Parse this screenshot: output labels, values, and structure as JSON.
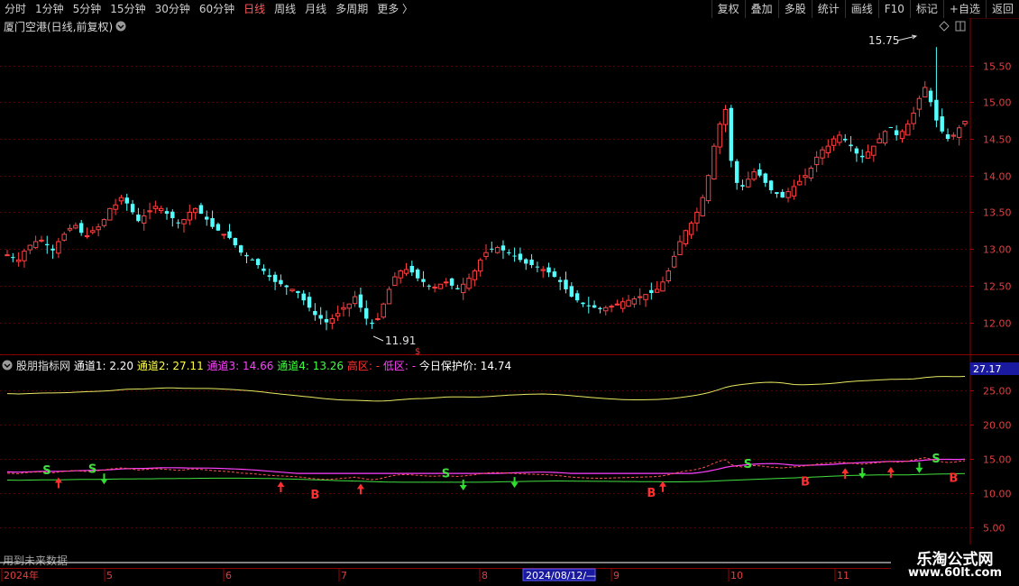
{
  "toolbar": {
    "left": [
      {
        "id": "tab-fenshi",
        "label": "分时",
        "active": false
      },
      {
        "id": "tab-1min",
        "label": "1分钟",
        "active": false
      },
      {
        "id": "tab-5min",
        "label": "5分钟",
        "active": false
      },
      {
        "id": "tab-15min",
        "label": "15分钟",
        "active": false
      },
      {
        "id": "tab-30min",
        "label": "30分钟",
        "active": false
      },
      {
        "id": "tab-60min",
        "label": "60分钟",
        "active": false
      },
      {
        "id": "tab-day",
        "label": "日线",
        "active": true
      },
      {
        "id": "tab-week",
        "label": "周线",
        "active": false
      },
      {
        "id": "tab-month",
        "label": "月线",
        "active": false
      },
      {
        "id": "tab-multi",
        "label": "多周期",
        "active": false
      },
      {
        "id": "tab-more",
        "label": "更多 〉",
        "active": false
      }
    ],
    "right": [
      {
        "id": "btn-fuquan",
        "label": "复权"
      },
      {
        "id": "btn-diejia",
        "label": "叠加"
      },
      {
        "id": "btn-duogu",
        "label": "多股"
      },
      {
        "id": "btn-tongji",
        "label": "统计"
      },
      {
        "id": "btn-huaxian",
        "label": "画线"
      },
      {
        "id": "btn-f10",
        "label": "F10"
      },
      {
        "id": "btn-biaoji",
        "label": "标记"
      },
      {
        "id": "btn-zixuan",
        "label": "+自选"
      },
      {
        "id": "btn-fanhui",
        "label": "返回"
      }
    ]
  },
  "main_chart": {
    "title": "厦门空港(日线,前复权)",
    "high_label": "15.75",
    "low_label": "11.91",
    "y_ticks": [
      "15.50",
      "15.00",
      "14.50",
      "14.00",
      "13.50",
      "13.00",
      "12.50",
      "12.00"
    ]
  },
  "indicator": {
    "name": "股朋指标网",
    "items": [
      {
        "label": "通道1: 2.20",
        "color": "#ffffff"
      },
      {
        "label": "通道2: 27.11",
        "color": "#ffff40"
      },
      {
        "label": "通道3: 14.66",
        "color": "#ff40ff"
      },
      {
        "label": "通道4: 13.26",
        "color": "#40ff40"
      },
      {
        "label": "高区: -",
        "color": "#ff3030"
      },
      {
        "label": "低区: -",
        "color": "#ff40ff"
      },
      {
        "label": "今日保护价: 14.74",
        "color": "#ffffff"
      }
    ],
    "y_ticks": [
      "25.00",
      "20.00",
      "15.00",
      "10.00",
      "5.00"
    ],
    "current_value": "27.17",
    "signals": [
      {
        "text": "S",
        "color": "#40e040"
      },
      {
        "text": "B",
        "color": "#ff3030"
      }
    ]
  },
  "x_axis": {
    "labels": [
      "2024年",
      "5",
      "6",
      "7",
      "8",
      "2024/08/12/—",
      "9",
      "10",
      "11"
    ]
  },
  "footer_note": "用到未来数据",
  "watermark": {
    "line1": "乐淘公式网",
    "line2": "www.60lt.com"
  },
  "colors": {
    "up": "#ff4040",
    "down": "#54ffff",
    "grid": "#5a0000",
    "axis_text": "#e04040"
  },
  "chart_data": {
    "type": "candlestick",
    "title": "厦门空港(日线,前复权)",
    "ylim": [
      11.7,
      15.9
    ],
    "marked_high": 15.75,
    "marked_low": 11.91,
    "x_labels": [
      "2024年",
      "5",
      "6",
      "7",
      "8",
      "9",
      "10",
      "11"
    ],
    "close": [
      12.92,
      12.88,
      12.85,
      12.97,
      13.05,
      13.1,
      13.12,
      13.05,
      12.98,
      13.1,
      13.2,
      13.28,
      13.32,
      13.22,
      13.18,
      13.25,
      13.3,
      13.4,
      13.55,
      13.6,
      13.7,
      13.62,
      13.5,
      13.38,
      13.45,
      13.52,
      13.58,
      13.55,
      13.48,
      13.42,
      13.35,
      13.4,
      13.5,
      13.55,
      13.48,
      13.4,
      13.3,
      13.25,
      13.2,
      13.15,
      13.05,
      12.95,
      12.9,
      12.85,
      12.78,
      12.7,
      12.62,
      12.55,
      12.52,
      12.48,
      12.45,
      12.4,
      12.3,
      12.2,
      12.1,
      12.05,
      12.0,
      12.05,
      12.12,
      12.2,
      12.25,
      12.35,
      12.2,
      12.05,
      11.98,
      12.05,
      12.25,
      12.45,
      12.62,
      12.7,
      12.72,
      12.68,
      12.6,
      12.55,
      12.5,
      12.48,
      12.52,
      12.55,
      12.5,
      12.45,
      12.52,
      12.6,
      12.7,
      12.85,
      12.95,
      13.0,
      13.02,
      12.98,
      12.95,
      12.9,
      12.85,
      12.8,
      12.78,
      12.75,
      12.72,
      12.68,
      12.62,
      12.55,
      12.45,
      12.35,
      12.3,
      12.25,
      12.22,
      12.2,
      12.18,
      12.2,
      12.22,
      12.25,
      12.28,
      12.3,
      12.32,
      12.35,
      12.38,
      12.4,
      12.45,
      12.55,
      12.7,
      12.9,
      13.1,
      13.25,
      13.35,
      13.5,
      13.7,
      14.0,
      14.4,
      14.7,
      14.9,
      14.2,
      13.9,
      13.85,
      13.95,
      14.05,
      14.0,
      13.9,
      13.8,
      13.75,
      13.7,
      13.78,
      13.85,
      13.92,
      14.0,
      14.1,
      14.25,
      14.35,
      14.4,
      14.5,
      14.55,
      14.48,
      14.4,
      14.3,
      14.25,
      14.32,
      14.4,
      14.5,
      14.6,
      14.65,
      14.55,
      14.6,
      14.7,
      14.85,
      15.05,
      15.2,
      15.0,
      14.75,
      14.6,
      14.5,
      14.55,
      14.65,
      14.74
    ],
    "indicator": {
      "channel1": 2.2,
      "channel2": 27.11,
      "channel3": 14.66,
      "channel4": 13.26,
      "protect_price": 14.74,
      "ylim": [
        3.0,
        28.5
      ]
    }
  }
}
